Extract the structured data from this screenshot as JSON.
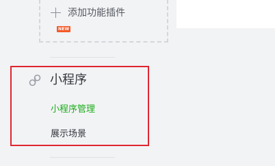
{
  "plugins": {
    "add_label": "添加功能插件",
    "new_badge": "NEW"
  },
  "sidebar": {
    "section_title": "小程序",
    "section_icon": "link-icon",
    "items": [
      {
        "label": "小程序管理",
        "active": true
      },
      {
        "label": "展示场景",
        "active": false
      }
    ]
  },
  "colors": {
    "active_item": "#1aad19",
    "highlight_border": "#e0252f",
    "new_badge": "#f45a2a"
  }
}
